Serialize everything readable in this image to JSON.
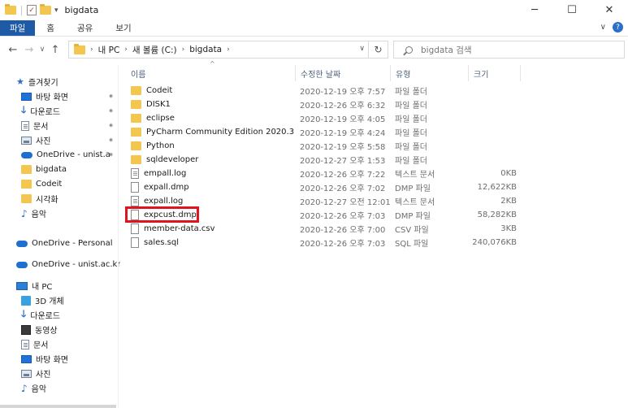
{
  "window": {
    "title": "bigdata",
    "controls": [
      "─",
      "☐",
      "✕"
    ]
  },
  "ribbon": {
    "tabs": [
      "파일",
      "홈",
      "공유",
      "보기"
    ],
    "right_chevron": "∨",
    "help": "?"
  },
  "nav_buttons": {
    "back": "←",
    "forward": "→",
    "recent": "∨",
    "up": "↑"
  },
  "address": {
    "crumbs": [
      "내 PC",
      "새 볼륨 (C:)",
      "bigdata"
    ],
    "refresh": "↻",
    "dropdown": "∨"
  },
  "search": {
    "placeholder": "bigdata 검색"
  },
  "columns": [
    "이름",
    "수정한 날짜",
    "유형",
    "크기"
  ],
  "sidebar": {
    "items": [
      {
        "label": "즐겨찾기",
        "icon": "star-icon"
      },
      {
        "label": "바탕 화면",
        "icon": "desktop-icon",
        "pin": "✷"
      },
      {
        "label": "다운로드",
        "icon": "download-icon",
        "pin": "✷"
      },
      {
        "label": "문서",
        "icon": "document-icon",
        "pin": "✷"
      },
      {
        "label": "사진",
        "icon": "pictures-icon",
        "pin": "✷"
      },
      {
        "label": "OneDrive - unist.ac.",
        "icon": "onedrive-icon",
        "pin": "✷"
      },
      {
        "label": "bigdata",
        "icon": "folder-icon"
      },
      {
        "label": "Codeit",
        "icon": "folder-icon"
      },
      {
        "label": "시각화",
        "icon": "folder-icon"
      },
      {
        "label": "음악",
        "icon": "music-icon"
      },
      {
        "label": "OneDrive - Personal",
        "icon": "onedrive-icon"
      },
      {
        "label": "OneDrive - unist.ac.kr",
        "icon": "onedrive-icon"
      },
      {
        "label": "내 PC",
        "icon": "pc-icon"
      },
      {
        "label": "3D 개체",
        "icon": "cube-icon"
      },
      {
        "label": "다운로드",
        "icon": "download-icon"
      },
      {
        "label": "동영상",
        "icon": "video-icon"
      },
      {
        "label": "문서",
        "icon": "document-icon"
      },
      {
        "label": "바탕 화면",
        "icon": "desktop-icon"
      },
      {
        "label": "사진",
        "icon": "pictures-icon"
      },
      {
        "label": "음악",
        "icon": "music-icon"
      }
    ]
  },
  "files": [
    {
      "name": "Codeit",
      "date": "2020-12-19 오후 7:57",
      "type": "파일 폴더",
      "size": "",
      "kind": "folder"
    },
    {
      "name": "DISK1",
      "date": "2020-12-26 오후 6:32",
      "type": "파일 폴더",
      "size": "",
      "kind": "folder"
    },
    {
      "name": "eclipse",
      "date": "2020-12-19 오후 4:05",
      "type": "파일 폴더",
      "size": "",
      "kind": "folder"
    },
    {
      "name": "PyCharm Community Edition 2020.3",
      "date": "2020-12-19 오후 4:24",
      "type": "파일 폴더",
      "size": "",
      "kind": "folder"
    },
    {
      "name": "Python",
      "date": "2020-12-19 오후 5:58",
      "type": "파일 폴더",
      "size": "",
      "kind": "folder"
    },
    {
      "name": "sqldeveloper",
      "date": "2020-12-27 오후 1:53",
      "type": "파일 폴더",
      "size": "",
      "kind": "folder"
    },
    {
      "name": "empall.log",
      "date": "2020-12-26 오후 7:22",
      "type": "텍스트 문서",
      "size": "0KB",
      "kind": "text"
    },
    {
      "name": "expall.dmp",
      "date": "2020-12-26 오후 7:02",
      "type": "DMP 파일",
      "size": "12,622KB",
      "kind": "file"
    },
    {
      "name": "expall.log",
      "date": "2020-12-27 오전 12:01",
      "type": "텍스트 문서",
      "size": "2KB",
      "kind": "text"
    },
    {
      "name": "expcust.dmp",
      "date": "2020-12-26 오후 7:03",
      "type": "DMP 파일",
      "size": "58,282KB",
      "kind": "file"
    },
    {
      "name": "member-data.csv",
      "date": "2020-12-26 오후 7:00",
      "type": "CSV 파일",
      "size": "3KB",
      "kind": "file"
    },
    {
      "name": "sales.sql",
      "date": "2020-12-26 오후 7:03",
      "type": "SQL 파일",
      "size": "240,076KB",
      "kind": "file"
    }
  ],
  "colors": {
    "file_tab": "#1f5aa6",
    "highlight": "#e0141e",
    "folder": "#f3c74f"
  }
}
